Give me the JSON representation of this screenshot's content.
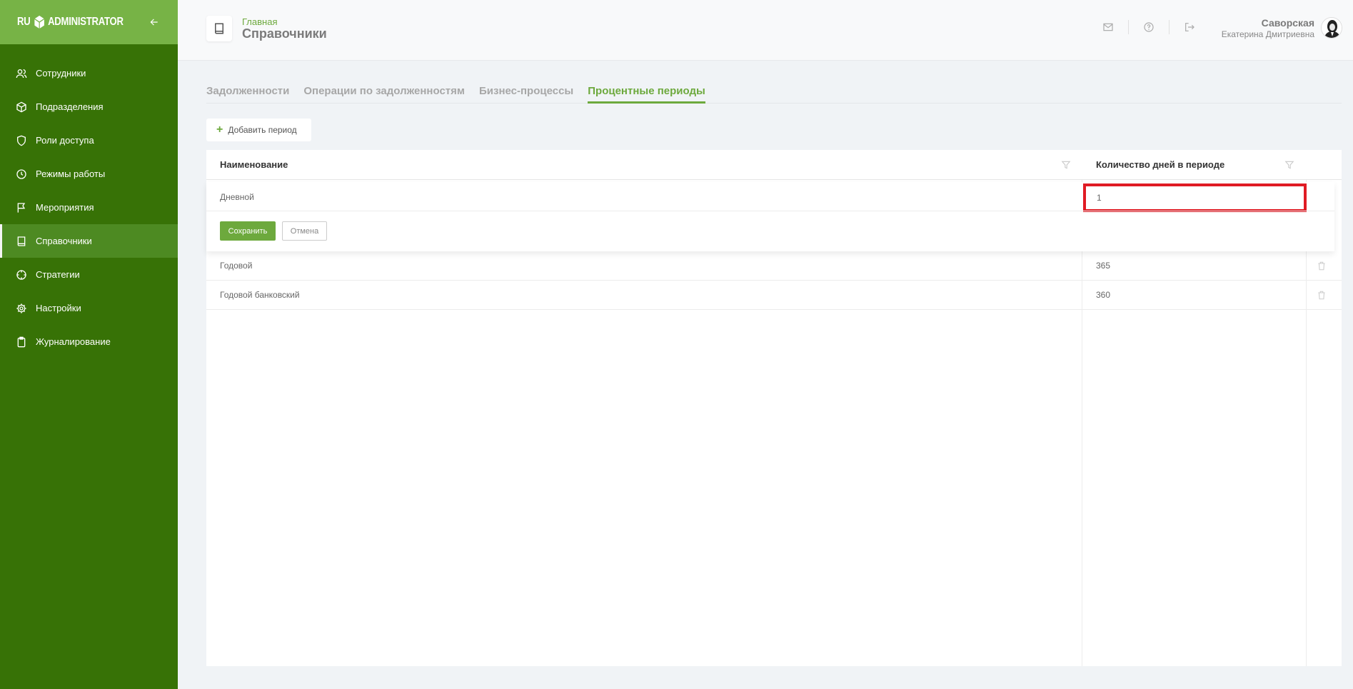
{
  "sidebar": {
    "logo_left": "RU",
    "logo_right": "ADMINISTRATOR",
    "items": [
      {
        "label": "Сотрудники",
        "icon": "users-icon"
      },
      {
        "label": "Подразделения",
        "icon": "cube-icon"
      },
      {
        "label": "Роли доступа",
        "icon": "shield-icon"
      },
      {
        "label": "Режимы работы",
        "icon": "clock-icon"
      },
      {
        "label": "Мероприятия",
        "icon": "flag-icon"
      },
      {
        "label": "Справочники",
        "icon": "book-icon",
        "active": true
      },
      {
        "label": "Стратегии",
        "icon": "crosshair-icon"
      },
      {
        "label": "Настройки",
        "icon": "gear-icon"
      },
      {
        "label": "Журналирование",
        "icon": "clipboard-icon"
      }
    ]
  },
  "header": {
    "breadcrumb": "Главная",
    "title": "Справочники",
    "user": {
      "last_name": "Саворская",
      "first_names": "Екатерина Дмитриевна"
    }
  },
  "tabs": [
    {
      "label": "Задолженности"
    },
    {
      "label": "Операции по задолженностям"
    },
    {
      "label": "Бизнес-процессы"
    },
    {
      "label": "Процентные периоды",
      "active": true
    }
  ],
  "add_button": {
    "label": "Добавить период"
  },
  "table": {
    "columns": [
      "Наименование",
      "Количество дней в периоде"
    ],
    "editing_row": {
      "name": "Дневной",
      "days": "1",
      "save_label": "Сохранить",
      "cancel_label": "Отмена"
    },
    "rows": [
      {
        "name": "Годовой",
        "days": "365"
      },
      {
        "name": "Годовой банковский",
        "days": "360"
      }
    ]
  },
  "colors": {
    "accent": "#6da93d",
    "sidebar": "#377206",
    "logo_bar": "#77b346",
    "highlight": "#e01b24"
  }
}
